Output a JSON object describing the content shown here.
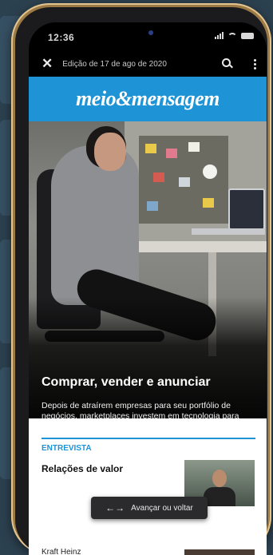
{
  "status_bar": {
    "time": "12:36"
  },
  "top_bar": {
    "close_icon": "close-icon",
    "edition_label": "Edição de 17 de ago de 2020",
    "search_icon": "search-icon",
    "menu_icon": "more-vert-icon"
  },
  "brand": {
    "logo_text": "meio&mensagem",
    "color": "#1e93d6"
  },
  "hero": {
    "title": "Comprar, vender e anunciar",
    "summary": "Depois de atraírem empresas para seu portfólio de negócios, marketplaces investem em tecnologia para serviços de publicidade online"
  },
  "section": {
    "label": "ENTREVISTA",
    "articles": [
      {
        "title": "Relações de valor"
      },
      {
        "title": "Kraft Heinz"
      }
    ]
  },
  "toast": {
    "icon": "swap-horizontal-icon",
    "label": "Avançar ou voltar"
  }
}
